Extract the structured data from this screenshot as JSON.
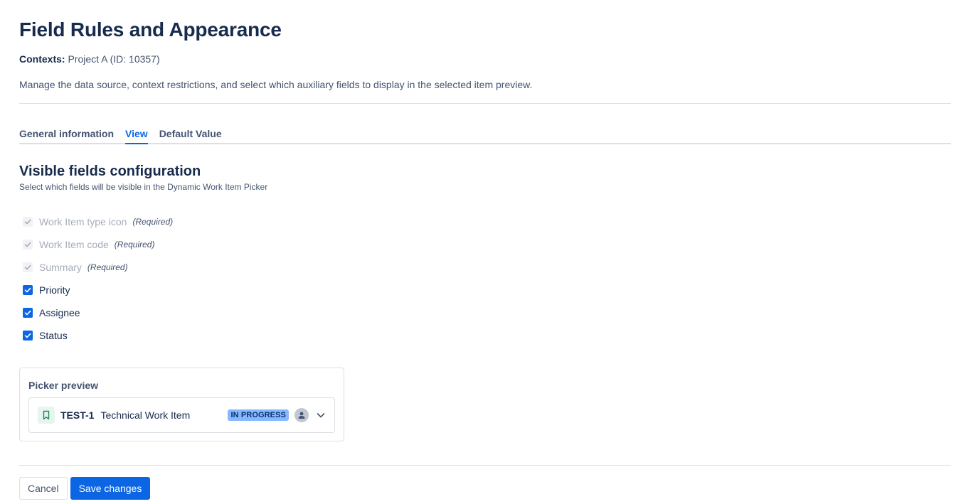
{
  "header": {
    "title": "Field Rules and Appearance",
    "contexts_label": "Contexts:",
    "contexts_value": "Project A (ID: 10357)",
    "description": "Manage the data source, context restrictions, and select which auxiliary fields to display in the selected item preview."
  },
  "tabs": [
    {
      "label": "General information",
      "active": false
    },
    {
      "label": "View",
      "active": true
    },
    {
      "label": "Default Value",
      "active": false
    }
  ],
  "section": {
    "title": "Visible fields configuration",
    "subtitle": "Select which fields will be visible in the Dynamic Work Item Picker"
  },
  "required_tag": "(Required)",
  "fields": [
    {
      "label": "Work Item type icon",
      "checked": true,
      "required": true
    },
    {
      "label": "Work Item code",
      "checked": true,
      "required": true
    },
    {
      "label": "Summary",
      "checked": true,
      "required": true
    },
    {
      "label": "Priority",
      "checked": true,
      "required": false
    },
    {
      "label": "Assignee",
      "checked": true,
      "required": false
    },
    {
      "label": "Status",
      "checked": true,
      "required": false
    }
  ],
  "preview": {
    "title": "Picker preview",
    "item_key": "TEST-1",
    "item_summary": "Technical Work Item",
    "status": "IN PROGRESS",
    "type_icon": "bookmark-icon",
    "avatar_icon": "person-icon",
    "expand_icon": "chevron-down-icon"
  },
  "actions": {
    "cancel_label": "Cancel",
    "save_label": "Save changes"
  },
  "colors": {
    "primary": "#0c66e4",
    "lozenge_bg": "#85b8ff",
    "text": "#172b4d"
  }
}
